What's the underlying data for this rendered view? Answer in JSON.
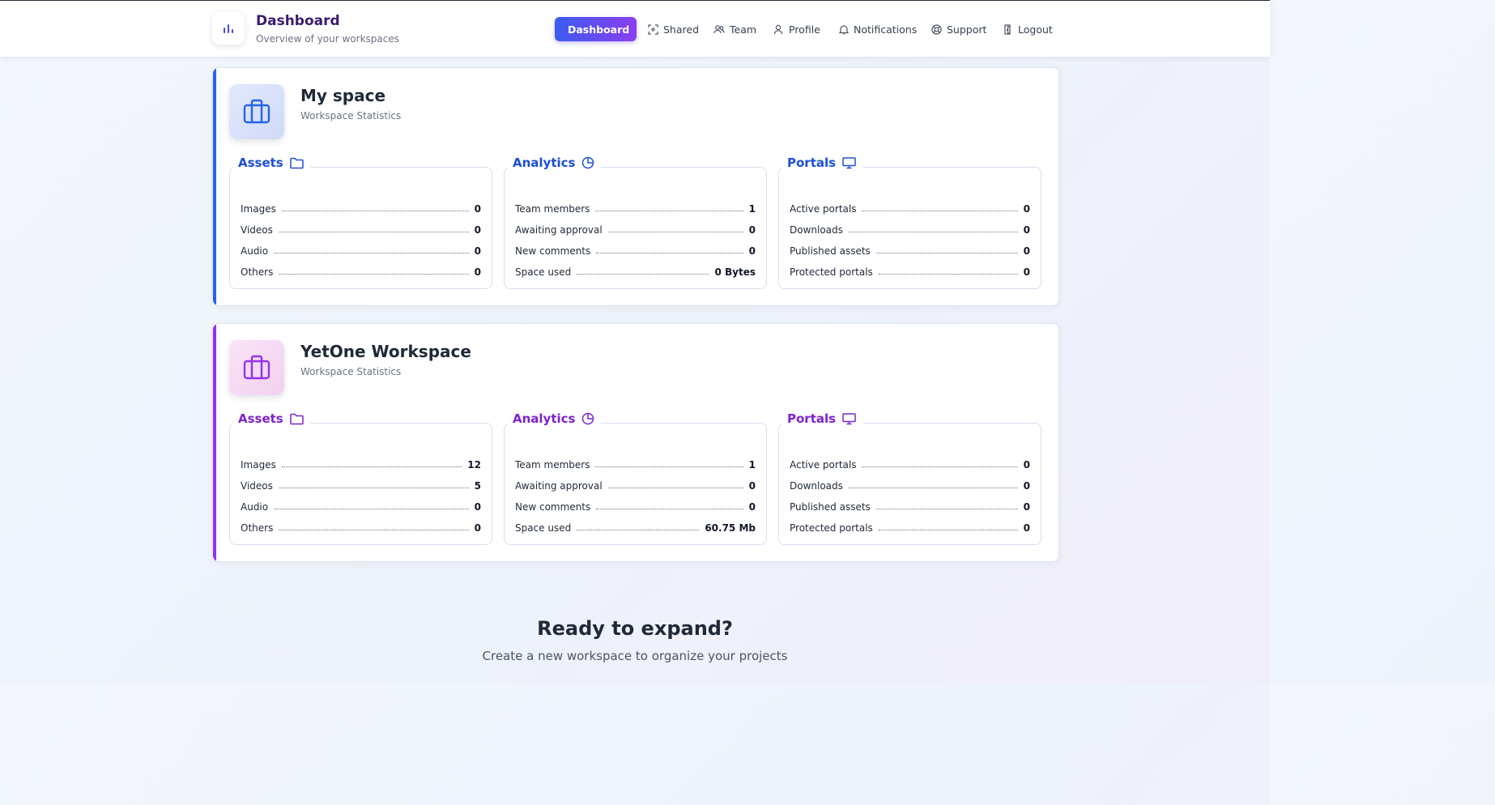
{
  "header": {
    "title": "Dashboard",
    "subtitle": "Overview of your workspaces",
    "logo_icon": "bar-chart-icon"
  },
  "nav": [
    {
      "label": "Dashboard",
      "icon": "bar-chart-icon",
      "active": true
    },
    {
      "label": "Shared",
      "icon": "share-icon",
      "active": false
    },
    {
      "label": "Team",
      "icon": "users-icon",
      "active": false
    },
    {
      "label": "Profile",
      "icon": "user-icon",
      "active": false
    },
    {
      "label": "Notifications",
      "icon": "bell-icon",
      "active": false
    },
    {
      "label": "Support",
      "icon": "lifebuoy-icon",
      "active": false
    },
    {
      "label": "Logout",
      "icon": "logout-icon",
      "active": false
    }
  ],
  "workspaces": [
    {
      "name": "My space",
      "subtitle": "Workspace Statistics",
      "accent": "#1d4ed8",
      "stripe": "#2563eb",
      "icon_bg": "#dbe4fb",
      "sections": {
        "assets": {
          "title": "Assets",
          "rows": [
            {
              "label": "Images",
              "value": "0"
            },
            {
              "label": "Videos",
              "value": "0"
            },
            {
              "label": "Audio",
              "value": "0"
            },
            {
              "label": "Others",
              "value": "0"
            }
          ]
        },
        "analytics": {
          "title": "Analytics",
          "rows": [
            {
              "label": "Team members",
              "value": "1"
            },
            {
              "label": "Awaiting approval",
              "value": "0"
            },
            {
              "label": "New comments",
              "value": "0"
            },
            {
              "label": "Space used",
              "value": "0 Bytes"
            }
          ]
        },
        "portals": {
          "title": "Portals",
          "rows": [
            {
              "label": "Active portals",
              "value": "0"
            },
            {
              "label": "Downloads",
              "value": "0"
            },
            {
              "label": "Published assets",
              "value": "0"
            },
            {
              "label": "Protected portals",
              "value": "0"
            }
          ]
        }
      }
    },
    {
      "name": "YetOne Workspace",
      "subtitle": "Workspace Statistics",
      "accent": "#7e22ce",
      "stripe": "#9333ea",
      "icon_bg": "#f6dcf3",
      "sections": {
        "assets": {
          "title": "Assets",
          "rows": [
            {
              "label": "Images",
              "value": "12"
            },
            {
              "label": "Videos",
              "value": "5"
            },
            {
              "label": "Audio",
              "value": "0"
            },
            {
              "label": "Others",
              "value": "0"
            }
          ]
        },
        "analytics": {
          "title": "Analytics",
          "rows": [
            {
              "label": "Team members",
              "value": "1"
            },
            {
              "label": "Awaiting approval",
              "value": "0"
            },
            {
              "label": "New comments",
              "value": "0"
            },
            {
              "label": "Space used",
              "value": "60.75 Mb"
            }
          ]
        },
        "portals": {
          "title": "Portals",
          "rows": [
            {
              "label": "Active portals",
              "value": "0"
            },
            {
              "label": "Downloads",
              "value": "0"
            },
            {
              "label": "Published assets",
              "value": "0"
            },
            {
              "label": "Protected portals",
              "value": "0"
            }
          ]
        }
      }
    }
  ],
  "cta": {
    "title": "Ready to expand?",
    "subtitle": "Create a new workspace to organize your projects"
  }
}
